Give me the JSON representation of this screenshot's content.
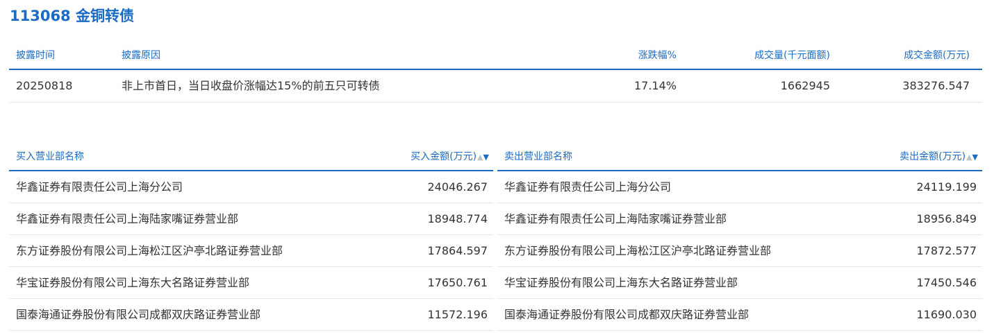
{
  "title": "113068 金铜转债",
  "summary": {
    "headers": {
      "date": "披露时间",
      "reason": "披露原因",
      "change": "涨跌幅%",
      "volume": "成交量(千元面额)",
      "amount": "成交金额(万元)"
    },
    "row": {
      "date": "20250818",
      "reason": "非上市首日，当日收盘价涨幅达15%的前五只可转债",
      "change": "17.14%",
      "volume": "1662945",
      "amount": "383276.547"
    }
  },
  "buy": {
    "header_name": "买入营业部名称",
    "header_value": "买入金额(万元)",
    "sort_up": "▲",
    "sort_down": "▼",
    "rows": [
      {
        "name": "华鑫证券有限责任公司上海分公司",
        "value": "24046.267"
      },
      {
        "name": "华鑫证券有限责任公司上海陆家嘴证券营业部",
        "value": "18948.774"
      },
      {
        "name": "东方证券股份有限公司上海松江区沪亭北路证券营业部",
        "value": "17864.597"
      },
      {
        "name": "华宝证券股份有限公司上海东大名路证券营业部",
        "value": "17650.761"
      },
      {
        "name": "国泰海通证券股份有限公司成都双庆路证券营业部",
        "value": "11572.196"
      }
    ]
  },
  "sell": {
    "header_name": "卖出营业部名称",
    "header_value": "卖出金额(万元)",
    "sort_up": "▲",
    "sort_down": "▼",
    "rows": [
      {
        "name": "华鑫证券有限责任公司上海分公司",
        "value": "24119.199"
      },
      {
        "name": "华鑫证券有限责任公司上海陆家嘴证券营业部",
        "value": "18956.849"
      },
      {
        "name": "东方证券股份有限公司上海松江区沪亭北路证券营业部",
        "value": "17872.577"
      },
      {
        "name": "华宝证券股份有限公司上海东大名路证券营业部",
        "value": "17450.546"
      },
      {
        "name": "国泰海通证券股份有限公司成都双庆路证券营业部",
        "value": "11690.030"
      }
    ]
  },
  "colors": {
    "accent": "#1a6bc4",
    "text": "#333333",
    "divider": "#e6e6e6",
    "sort_inactive": "#c0c0c0"
  }
}
